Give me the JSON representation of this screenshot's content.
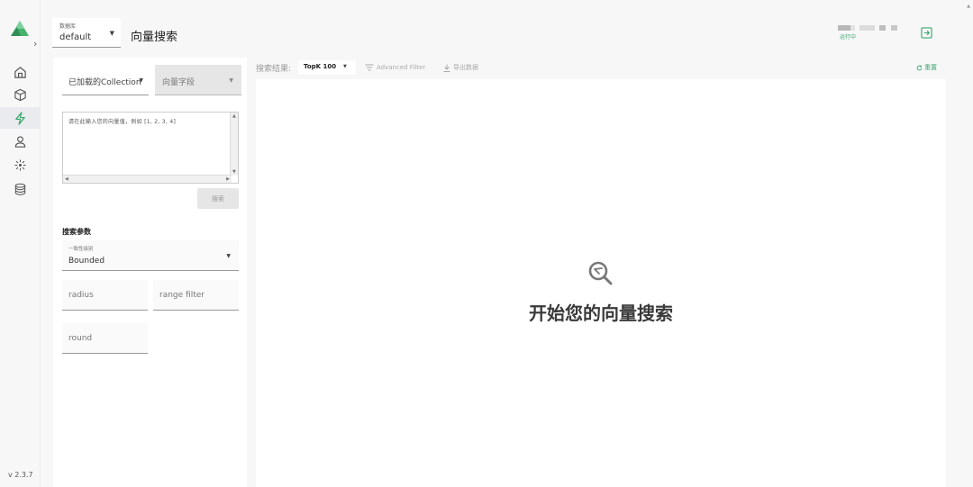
{
  "app": {
    "version": "v 2.3.7"
  },
  "nav": {
    "items": [
      {
        "name": "home-icon",
        "active": false
      },
      {
        "name": "cube-icon",
        "active": false
      },
      {
        "name": "search-lightning-icon",
        "active": true
      },
      {
        "name": "user-icon",
        "active": false
      },
      {
        "name": "system-icon",
        "active": false
      },
      {
        "name": "database-icon",
        "active": false
      }
    ]
  },
  "header": {
    "db_label": "数据库",
    "db_value": "default",
    "title": "向量搜索",
    "status_text": "运行中"
  },
  "left_panel": {
    "collection_label": "已加载的Collection",
    "vector_field_label": "向量字段",
    "vector_placeholder": "请在此输入您的向量值，例如 [1, 2, 3, 4]",
    "search_button": "搜索",
    "params_title": "搜索参数",
    "consistency_label": "一致性级别",
    "consistency_value": "Bounded",
    "radius_label": "radius",
    "range_filter_label": "range filter",
    "round_label": "round"
  },
  "results": {
    "label": "搜索结果:",
    "topk": "TopK 100",
    "advanced_filter": "Advanced Filter",
    "export": "导出数据",
    "reset": "重置",
    "empty_text": "开始您的向量搜索"
  },
  "colors": {
    "accent": "#3aa76d",
    "disabled_bg": "#e6e6e6"
  }
}
